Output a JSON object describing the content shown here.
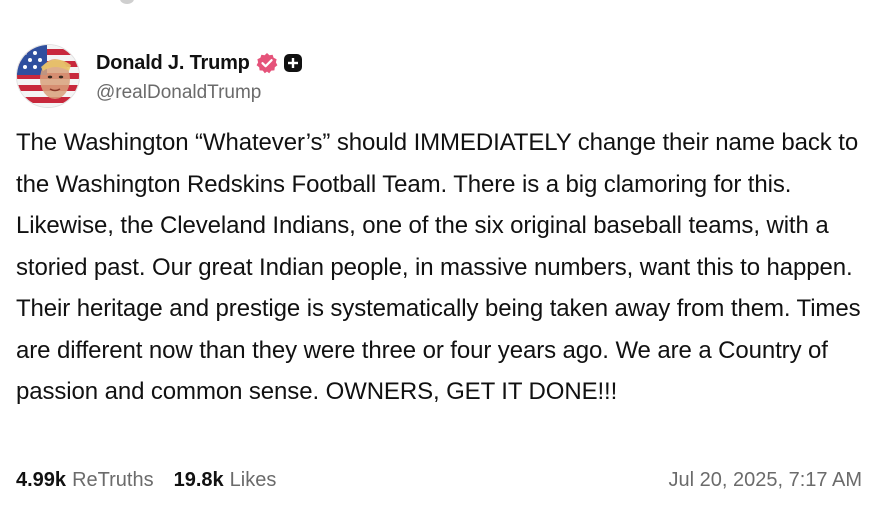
{
  "author": {
    "display_name": "Donald J. Trump",
    "handle": "@realDonaldTrump",
    "avatar_icon": "flag-portrait-avatar",
    "verified_icon": "verified-badge-icon",
    "extra_badge_icon": "plus-badge-icon"
  },
  "post": {
    "text": "The Washington “Whatever’s” should IMMEDIATELY change their name back to the Washington Redskins Football Team. There is a big clamoring for this. Likewise, the Cleveland Indians, one of the six original baseball teams, with a storied past. Our great Indian people, in massive numbers, want this to happen. Their heritage and prestige is systematically being taken away from them. Times are different now than they were three or four years ago. We are a Country of passion and common sense. OWNERS, GET IT DONE!!!"
  },
  "stats": {
    "retruths_count": "4.99k",
    "retruths_label": "ReTruths",
    "likes_count": "19.8k",
    "likes_label": "Likes"
  },
  "timestamp": "Jul 20, 2025, 7:17 AM",
  "colors": {
    "text": "#111111",
    "muted": "#6b6b6b",
    "verified": "#e5537a",
    "badge": "#111111"
  }
}
